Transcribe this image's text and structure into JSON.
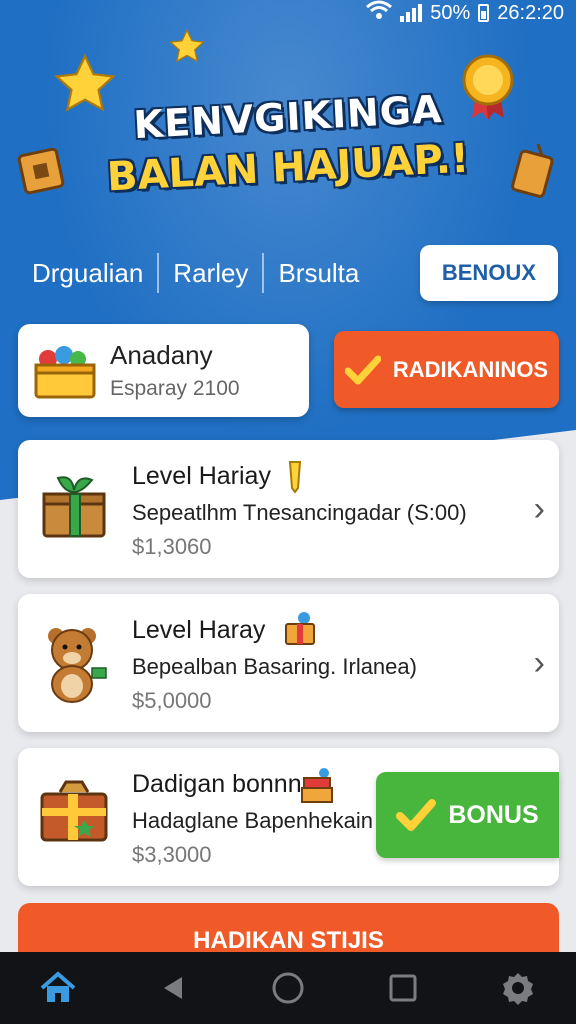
{
  "status_bar": {
    "battery": "50%",
    "time": "26:2:20"
  },
  "title": {
    "line1": "KENVGIKINGA",
    "line2": "BALAN HAJUAP.!"
  },
  "tabs": [
    {
      "label": "Drgualian"
    },
    {
      "label": "Rarley"
    },
    {
      "label": "Brsulta"
    },
    {
      "label": "BENOUX",
      "active": true
    }
  ],
  "summary": {
    "title": "Anadany",
    "subtitle": "Esparay 2100",
    "action_label": "RADIKANINOS"
  },
  "items": [
    {
      "name": "Level Hariay",
      "description": "Sepeatlhm Tnesancingadar (S:00)",
      "amount": "$1,3060"
    },
    {
      "name": "Level Haray",
      "description": "Bepealban Basaring. Irlanea)",
      "amount": "$5,0000"
    },
    {
      "name": "Dadigan bonnn",
      "description": "Hadaglane Bapenhekain",
      "amount": "$3,3000",
      "action_label": "BONUS"
    }
  ],
  "bottom_button": {
    "label": "HADIKAN STIJIS"
  },
  "colors": {
    "header_blue": "#1f6fc4",
    "orange": "#f05a28",
    "green": "#48b53c",
    "gold": "#ffd23a"
  },
  "nav_icons": [
    "home-icon",
    "back-icon",
    "circle-home-icon",
    "recents-icon",
    "settings-icon"
  ]
}
